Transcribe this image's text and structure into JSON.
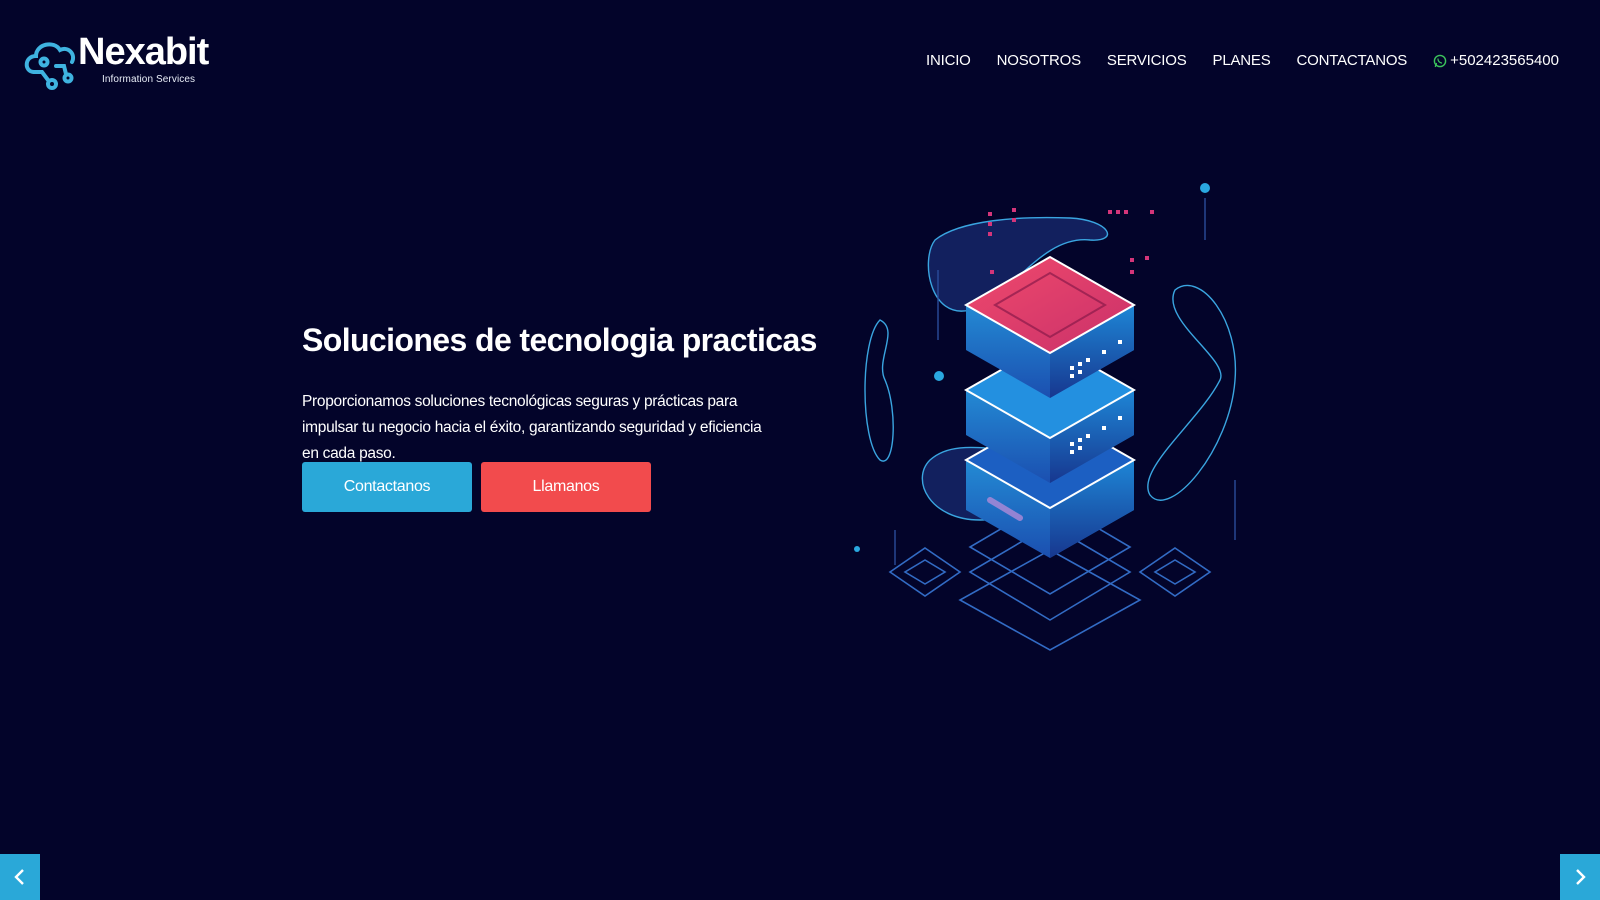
{
  "brand": {
    "name": "Nexabit",
    "tagline": "Information Services"
  },
  "nav": {
    "items": [
      "INICIO",
      "NOSOTROS",
      "SERVICIOS",
      "PLANES",
      "CONTACTANOS"
    ],
    "phone": "+502423565400"
  },
  "hero": {
    "title": "Soluciones de tecnologia practicas",
    "description": "Proporcionamos soluciones tecnológicas seguras y prácticas para impulsar tu negocio hacia el éxito, garantizando seguridad y eficiencia en cada paso.",
    "primary_button": "Contactanos",
    "secondary_button": "Llamanos"
  },
  "colors": {
    "background": "#03042a",
    "primary_button": "#2aa8d8",
    "secondary_button": "#f24b4d",
    "server_top": "#e0436a",
    "server_body": "#1f7fd0"
  },
  "icons": {
    "logo": "cloud-network-icon",
    "phone": "whatsapp-icon",
    "prev": "chevron-left-icon",
    "next": "chevron-right-icon"
  }
}
